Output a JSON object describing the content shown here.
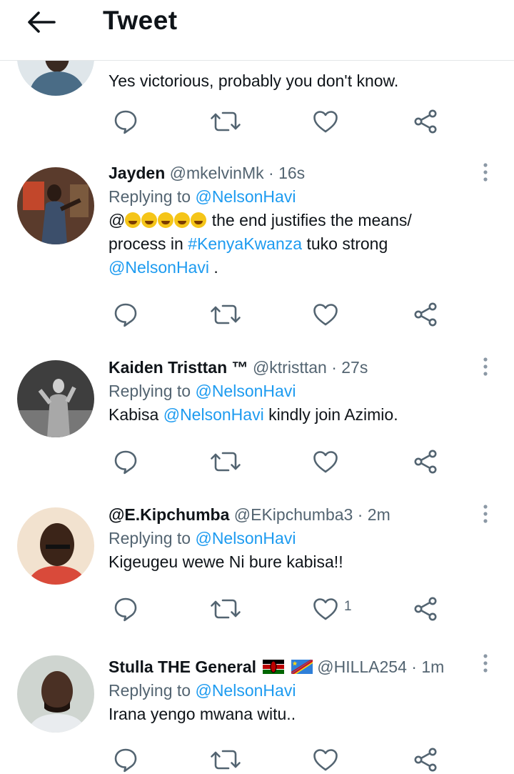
{
  "header": {
    "title": "Tweet"
  },
  "icons": {
    "back": "arrow-left-icon",
    "reply": "reply-icon",
    "retweet": "retweet-icon",
    "like": "heart-icon",
    "share": "share-icon",
    "more": "more-vertical-icon"
  },
  "colors": {
    "link": "#1d9bf0",
    "muted": "#536471",
    "text": "#0f1419",
    "divider": "#e3e6e8"
  },
  "tweets": [
    {
      "text": "Yes victorious, probably you don't know."
    },
    {
      "name": "Jayden",
      "handle": "@mkelvinMk",
      "time": "· 16s",
      "replying_prefix": "Replying to",
      "replying_to": "@NelsonHavi",
      "text_at": "@",
      "text_mid": " the end justifies the means/",
      "text_line2": "process in ",
      "hashtag": "#KenyaKwanza",
      "text_after_hashtag": " tuko strong",
      "mention_end": "@NelsonHavi",
      "text_end": " ."
    },
    {
      "name": "Kaiden Tristtan ™",
      "handle": "@ktristtan",
      "time": "· 27s",
      "replying_prefix": "Replying to",
      "replying_to": "@NelsonHavi",
      "text_before": "Kabisa ",
      "mention": "@NelsonHavi",
      "text_after": " kindly join Azimio."
    },
    {
      "name": "@E.Kipchumba",
      "handle": "@EKipchumba3",
      "time": "· 2m",
      "replying_prefix": "Replying to",
      "replying_to": "@NelsonHavi",
      "text": "Kigeugeu wewe Ni bure kabisa!!",
      "like_count": "1"
    },
    {
      "name": "Stulla THE General",
      "handle": "@HILLA254",
      "time": "· 1m",
      "replying_prefix": "Replying to",
      "replying_to": "@NelsonHavi",
      "text": "Irana yengo mwana witu.."
    }
  ]
}
